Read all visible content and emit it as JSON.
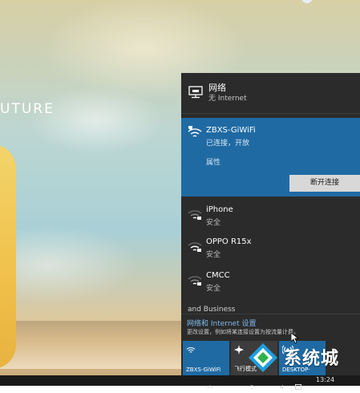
{
  "desktop": {
    "wallpaper_text": "UTURE"
  },
  "network_flyout": {
    "header": {
      "title": "网络",
      "subtitle": "无 Internet",
      "icon": "ethernet-icon"
    },
    "connected": {
      "name": "ZBXS-GiWiFi",
      "status": "已连接，开放",
      "properties": "属性",
      "disconnect": "断开连接",
      "icon": "wifi-open-icon"
    },
    "networks": [
      {
        "name": "iPhone",
        "security": "安全",
        "icon": "wifi-secured-icon"
      },
      {
        "name": "OPPO R15x",
        "security": "安全",
        "icon": "wifi-secured-icon"
      },
      {
        "name": "CMCC",
        "security": "安全",
        "icon": "wifi-secured-icon"
      }
    ],
    "partial_item": "and Business",
    "settings": {
      "link": "网络和 Internet 设置",
      "description": "更改设置，例如将某连接设置为按流量计费。"
    },
    "tiles": [
      {
        "label": "ZBXS-GiWiFi",
        "icon": "wifi-icon"
      },
      {
        "label": "飞行模式",
        "icon": "airplane-icon"
      },
      {
        "label": "DESKTOP-",
        "icon": "mobile-hotspot-icon"
      }
    ]
  },
  "watermark": {
    "text": "系统城"
  },
  "taskbar": {
    "time": "13:24"
  },
  "colors": {
    "accent": "#1f6aa3",
    "flyout_bg": "#2b2b2b",
    "link": "#7db9ec"
  }
}
